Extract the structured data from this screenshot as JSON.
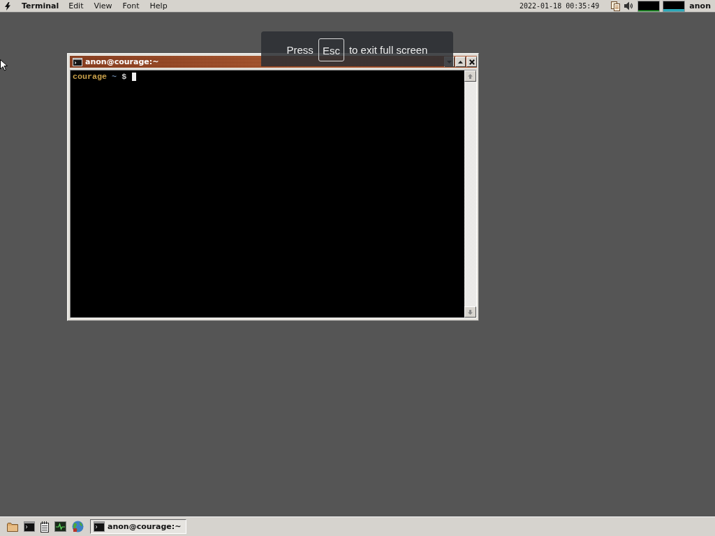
{
  "menu_bar": {
    "app": "Terminal",
    "menus": [
      "Edit",
      "View",
      "Font",
      "Help"
    ],
    "clock": "2022-01-18 00:35:49",
    "user": "anon"
  },
  "window": {
    "title": "anon@courage:~",
    "prompt": {
      "host": "courage",
      "path": "~",
      "symbol": "$"
    }
  },
  "fullscreen_notice": {
    "before": "Press",
    "key": "Esc",
    "after": "to exit full screen"
  },
  "taskbar": {
    "tasks": [
      {
        "title": "anon@courage:~",
        "selected": true
      }
    ]
  }
}
